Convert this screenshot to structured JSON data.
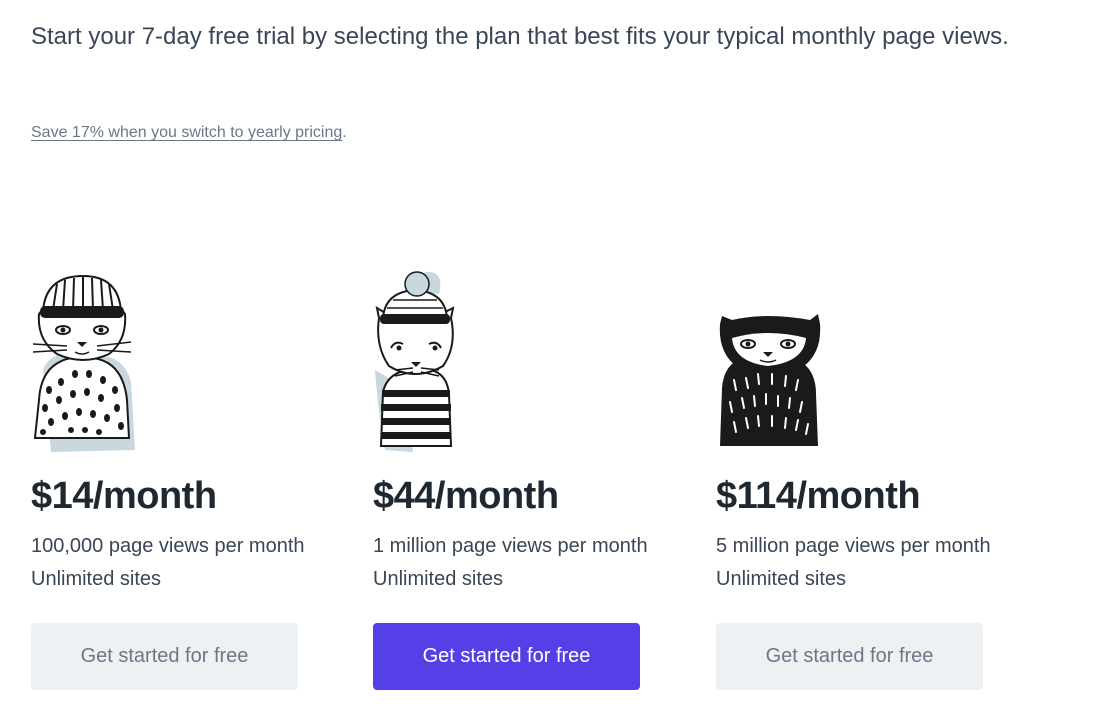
{
  "intro": {
    "text": "Start your 7-day free trial by selecting the plan that best fits your typical monthly page views."
  },
  "yearly": {
    "link_text": "Save 17% when you switch to yearly pricing",
    "suffix": "."
  },
  "plans": [
    {
      "illustration": "cat-knit-beanie-spotted-sweater",
      "price": "$14/month",
      "features": [
        "100,000 page views per month",
        "Unlimited sites"
      ],
      "cta": "Get started for free",
      "highlighted": false
    },
    {
      "illustration": "cat-pompom-hat-striped-sweater",
      "price": "$44/month",
      "features": [
        "1 million page views per month",
        "Unlimited sites"
      ],
      "cta": "Get started for free",
      "highlighted": true
    },
    {
      "illustration": "cat-black-balaclava",
      "price": "$114/month",
      "features": [
        "5 million page views per month",
        "Unlimited sites"
      ],
      "cta": "Get started for free",
      "highlighted": false
    }
  ],
  "colors": {
    "accent": "#5540e8",
    "secondary_button_bg": "#eef1f4",
    "text": "#3a4656",
    "heading": "#1f2730",
    "muted": "#6b7787",
    "shadow_blue": "#c9d7df"
  }
}
